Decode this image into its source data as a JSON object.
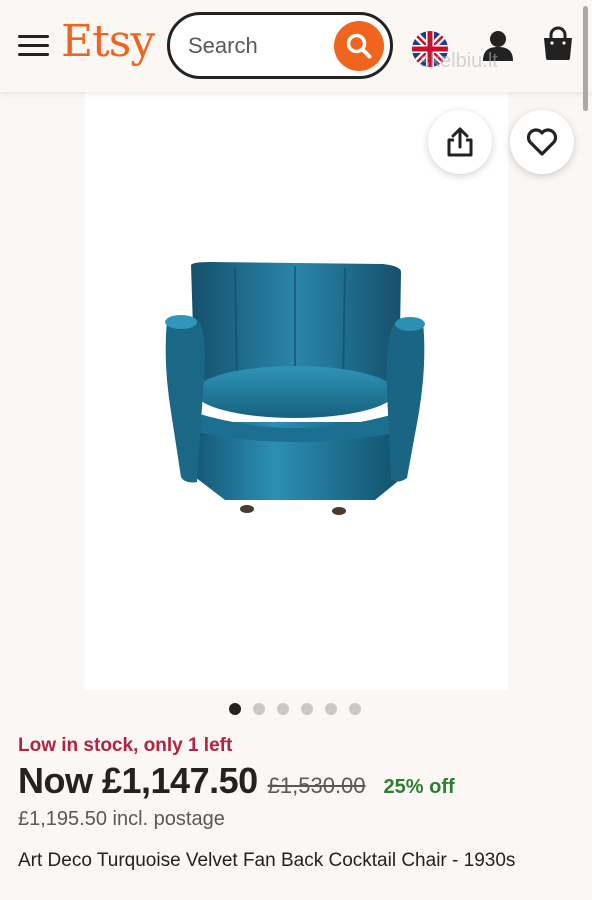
{
  "header": {
    "logo": "Etsy",
    "search_placeholder": "Search"
  },
  "watermark": "skelbiu.lt",
  "product": {
    "image_count": 6,
    "active_image": 1,
    "stock_notice": "Low in stock, only 1 left",
    "price_now": "Now £1,147.50",
    "price_original": "£1,530.00",
    "discount": "25% off",
    "postage": "£1,195.50 incl. postage",
    "title": "Art Deco Turquoise Velvet Fan Back Cocktail Chair - 1930s"
  },
  "colors": {
    "brand": "#f1641e",
    "stock": "#b3233e",
    "discount": "#2e7d32",
    "chair": "#1f6e8e"
  },
  "icons": [
    "menu-icon",
    "search-icon",
    "uk-flag-icon",
    "user-icon",
    "shopping-bag-icon",
    "share-icon",
    "heart-icon"
  ]
}
